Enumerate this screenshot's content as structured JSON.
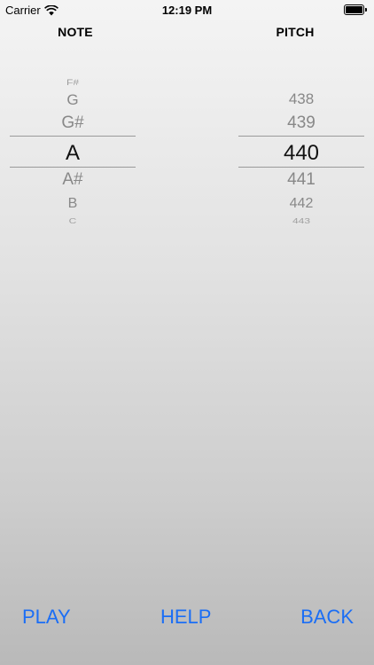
{
  "status_bar": {
    "carrier": "Carrier",
    "time": "12:19 PM",
    "wifi_icon": "wifi-icon",
    "battery_icon": "battery-full-icon"
  },
  "headers": {
    "note": "NOTE",
    "pitch": "PITCH"
  },
  "note_picker": {
    "items": [
      "F#",
      "G",
      "G#",
      "A",
      "A#",
      "B",
      "C"
    ],
    "selected": "A"
  },
  "pitch_picker": {
    "items": [
      "438",
      "439",
      "440",
      "441",
      "442",
      "443"
    ],
    "selected": "440"
  },
  "toolbar": {
    "play_label": "PLAY",
    "help_label": "HELP",
    "back_label": "BACK"
  },
  "colors": {
    "accent": "#1b6ef5"
  }
}
